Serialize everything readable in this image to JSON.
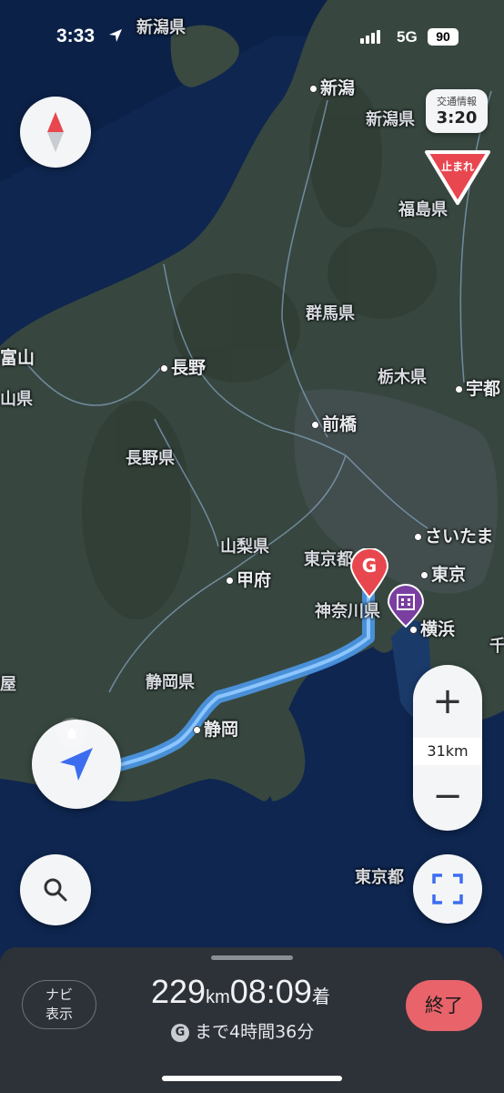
{
  "status_bar": {
    "time": "3:33",
    "network": "5G",
    "battery": "90"
  },
  "traffic_info": {
    "label": "交通情報",
    "time": "3:20"
  },
  "stop_sign": {
    "text": "止まれ"
  },
  "map_labels": {
    "niigata_pref_top": "新潟県",
    "niigata_city": "新潟",
    "niigata_pref": "新潟県",
    "fukushima_pref": "福島県",
    "gunma_pref": "群馬県",
    "toyama": "富山",
    "toyama_pref_partial": "山県",
    "nagano_city": "長野",
    "tochigi_pref": "栃木県",
    "utsunomiya_partial": "宇都",
    "maebashi": "前橋",
    "nagano_pref": "長野県",
    "saitama_partial": "さいたま",
    "yamanashi_pref": "山梨県",
    "tokyo_pref": "東京都",
    "kofu": "甲府",
    "tokyo": "東京",
    "kanagawa_pref": "神奈川県",
    "yokohama": "横浜",
    "chiba_partial": "千",
    "shizuoka_pref": "静岡県",
    "shizuoka_city": "静岡",
    "aichi_partial": "屋",
    "tokyo_pref_sea": "東京都"
  },
  "goal_marker": "G",
  "zoom": {
    "plus": "+",
    "minus": "−",
    "scale": "31km"
  },
  "bottom_panel": {
    "navi_button": [
      "ナビ",
      "表示"
    ],
    "distance": "229",
    "distance_unit": "km",
    "arrival_time": "08:09",
    "arrival_suffix": "着",
    "goal_icon": "G",
    "remaining": "まで4時間36分",
    "end_button": "終了"
  },
  "icons": [
    "location-arrow-icon",
    "compass-icon",
    "search-icon",
    "fullscreen-icon",
    "current-location-icon",
    "home-icon",
    "building-icon"
  ],
  "colors": {
    "route": "#4fa3ff",
    "goal": "#e8474f",
    "end_button": "#e8636a",
    "poi": "#7a3fa0"
  }
}
